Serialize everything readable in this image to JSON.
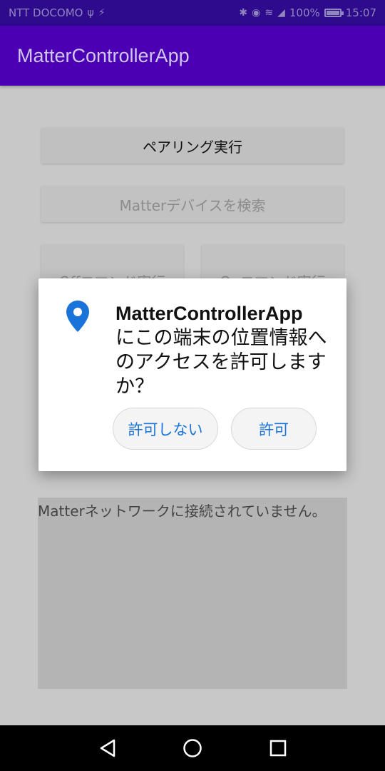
{
  "status_bar": {
    "carrier": "NTT DOCOMO",
    "battery_percent": "100%",
    "time": "15:07",
    "battery_level": 1.0
  },
  "app_bar": {
    "title": "MatterControllerApp"
  },
  "main": {
    "pairing_button": "ペアリング実行",
    "search_button": "Matterデバイスを検索",
    "off_button": "Offコマンド実行",
    "on_button": "Onコマンド実行",
    "status_text": "Matterネットワークに接続されていません。"
  },
  "dialog": {
    "app_name": "MatterControllerApp",
    "message": "にこの端末の位置情報へのアクセスを許可しますか？",
    "deny_button": "許可しない",
    "allow_button": "許可",
    "icon": "location-pin-icon",
    "accent_color": "#1a73d9"
  },
  "colors": {
    "status_bar_bg": "#2e0a8c",
    "app_bar_bg": "#4b00b4",
    "scrim": "#c8c8c8"
  }
}
